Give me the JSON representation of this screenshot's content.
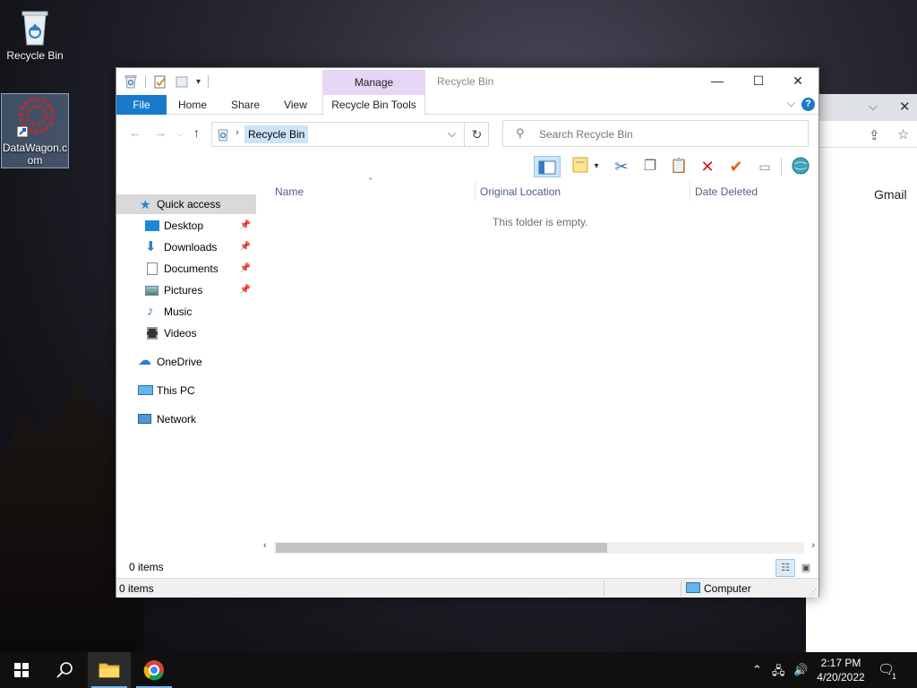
{
  "desktop": {
    "icons": [
      {
        "label": "Recycle Bin"
      },
      {
        "label": "DataWagon.c om"
      }
    ]
  },
  "background_window": {
    "gmail_text": "Gmail"
  },
  "explorer": {
    "title": "Recycle Bin",
    "contextual_group": "Manage",
    "ribbon_tabs": [
      "File",
      "Home",
      "Share",
      "View",
      "Recycle Bin Tools"
    ],
    "address": {
      "breadcrumb": "Recycle Bin"
    },
    "search": {
      "placeholder": "Search Recycle Bin"
    },
    "navigation": {
      "quick_access": "Quick access",
      "items": [
        "Desktop",
        "Downloads",
        "Documents",
        "Pictures",
        "Music",
        "Videos"
      ],
      "onedrive": "OneDrive",
      "this_pc": "This PC",
      "network": "Network"
    },
    "columns": [
      "Name",
      "Original Location",
      "Date Deleted"
    ],
    "empty_message": "This folder is empty.",
    "status_items": "0 items",
    "classic_status": {
      "items": "0 items",
      "zone": "Computer"
    }
  },
  "taskbar": {
    "time": "2:17 PM",
    "date": "4/20/2022",
    "notification_count": "1"
  },
  "colors": {
    "accent": "#1979ca",
    "manage_tab": "#e6d6f5",
    "selection": "#cce4f7"
  }
}
